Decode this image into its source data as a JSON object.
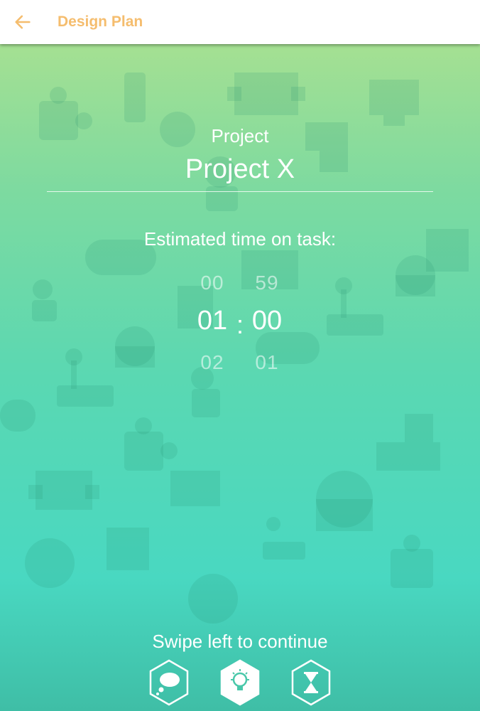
{
  "appbar": {
    "title": "Design Plan",
    "back_icon": "arrow-left-icon",
    "accent": "#f5bd6e"
  },
  "form": {
    "project_label": "Project",
    "project_name": "Project X",
    "estimated_label": "Estimated time on task:"
  },
  "time_picker": {
    "hours": {
      "prev": "00",
      "selected": "01",
      "next": "02"
    },
    "minutes": {
      "prev": "59",
      "selected": "00",
      "next": "01"
    },
    "separator": ":"
  },
  "footer": {
    "hint": "Swipe left to continue",
    "steps": [
      {
        "icon": "thought-bubble-icon",
        "active": false
      },
      {
        "icon": "lightbulb-icon",
        "active": true
      },
      {
        "icon": "hourglass-icon",
        "active": false
      }
    ]
  },
  "colors": {
    "gradient_top": "#a5e092",
    "gradient_bottom": "#3fbea6",
    "text": "#ffffff"
  }
}
